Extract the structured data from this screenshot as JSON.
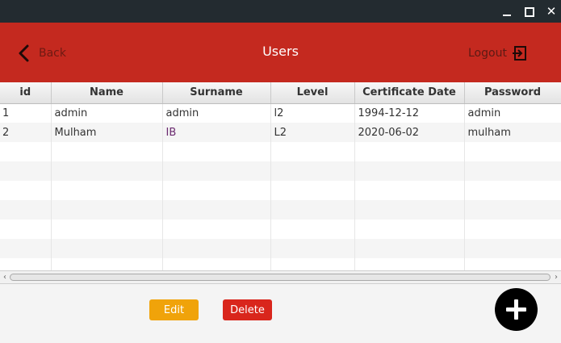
{
  "window": {
    "minimize_icon": "minimize-icon",
    "maximize_icon": "maximize-icon",
    "close_glyph": "✕"
  },
  "header": {
    "back_label": "Back",
    "title": "Users",
    "logout_label": "Logout",
    "color": "#c4291f"
  },
  "table": {
    "columns": [
      "id",
      "Name",
      "Surname",
      "Level",
      "Certificate Date",
      "Password"
    ],
    "rows": [
      {
        "id": "1",
        "name": "admin",
        "surname": "admin",
        "level": "l2",
        "date": "1994-12-12",
        "password": "admin"
      },
      {
        "id": "2",
        "name": "Mulham",
        "surname": "IB",
        "level": "L2",
        "date": "2020-06-02",
        "password": "mulham"
      }
    ],
    "empty_rows": 7
  },
  "actions": {
    "edit_label": "Edit",
    "delete_label": "Delete",
    "edit_color": "#f0a30a",
    "delete_color": "#d9261c",
    "add_icon": "plus-icon"
  }
}
